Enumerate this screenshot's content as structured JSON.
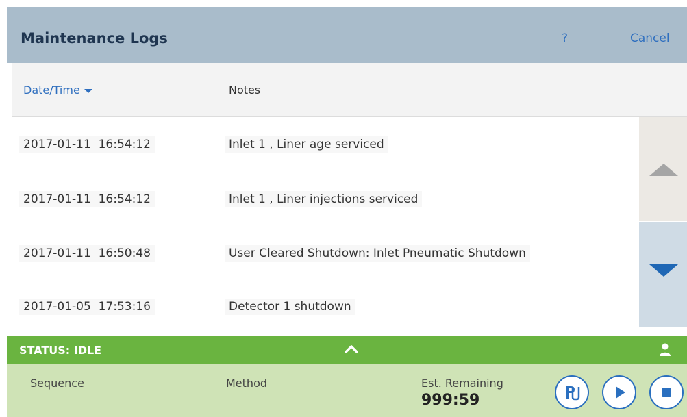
{
  "header": {
    "title": "Maintenance Logs",
    "help_label": "?",
    "cancel_label": "Cancel"
  },
  "table": {
    "columns": [
      "Date/Time",
      "Notes"
    ],
    "sort_indicator": "caret-down-icon",
    "rows": [
      {
        "datetime": "2017-01-11  16:54:12",
        "note": "Inlet 1 , Liner age serviced"
      },
      {
        "datetime": "2017-01-11  16:54:12",
        "note": "Inlet 1 , Liner injections serviced"
      },
      {
        "datetime": "2017-01-11  16:50:48",
        "note": "User Cleared Shutdown: Inlet Pneumatic Shutdown"
      },
      {
        "datetime": "2017-01-05  17:53:16",
        "note": "Detector 1 shutdown"
      }
    ]
  },
  "status": {
    "text": "STATUS: IDLE",
    "color": "#6ab440"
  },
  "run": {
    "sequence_label": "Sequence",
    "method_label": "Method",
    "est_remaining_label": "Est. Remaining",
    "est_remaining_value": "999:59"
  },
  "controls": {
    "icons": [
      "prep-icon",
      "play-icon",
      "stop-icon"
    ]
  },
  "colors": {
    "accent": "#2f6fbf",
    "header_bg": "#a9bccb",
    "status_green": "#6ab440",
    "bottom_bg": "#cfe3b6"
  }
}
